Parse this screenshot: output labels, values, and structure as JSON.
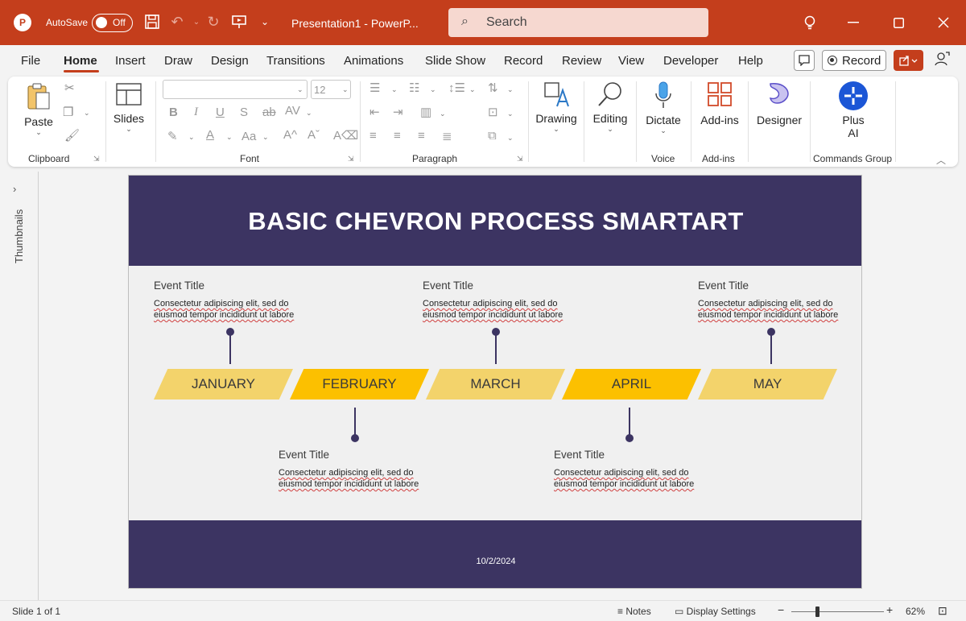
{
  "titlebar": {
    "autosave_label": "AutoSave",
    "autosave_state": "Off",
    "document_title": "Presentation1  -  PowerP...",
    "search_placeholder": "Search",
    "app_icon": "powerpoint-logo-icon",
    "accent_color": "#c43e1c"
  },
  "menu": {
    "tabs": [
      "File",
      "Home",
      "Insert",
      "Draw",
      "Design",
      "Transitions",
      "Animations",
      "Slide Show",
      "Record",
      "Review",
      "View",
      "Developer",
      "Help"
    ],
    "active_tab": "Home",
    "record_label": "Record"
  },
  "ribbon": {
    "clipboard": {
      "paste": "Paste",
      "group": "Clipboard"
    },
    "slides": {
      "label": "Slides"
    },
    "font": {
      "size": "12",
      "group": "Font"
    },
    "paragraph": {
      "group": "Paragraph"
    },
    "drawing": {
      "label": "Drawing"
    },
    "editing": {
      "label": "Editing"
    },
    "voice": {
      "dictate": "Dictate",
      "group": "Voice"
    },
    "addins": {
      "label": "Add-ins",
      "group": "Add-ins"
    },
    "designer": {
      "label": "Designer"
    },
    "commands": {
      "plus": "Plus",
      "ai": "AI",
      "group": "Commands Group"
    }
  },
  "thumbnails": {
    "label": "Thumbnails"
  },
  "slide": {
    "title": "BASIC CHEVRON PROCESS SMARTART",
    "date": "10/2/2024",
    "header_color": "#3c3462",
    "chevrons": [
      "JANUARY",
      "FEBRUARY",
      "MARCH",
      "APRIL",
      "MAY"
    ],
    "chevron_colors": {
      "light": "#f3d36b",
      "dark": "#fcc000"
    },
    "events_top": [
      {
        "title": "Event Title",
        "desc": "Consectetur adipiscing elit, sed do eiusmod tempor incididunt ut labore"
      },
      {
        "title": "Event Title",
        "desc": "Consectetur adipiscing elit, sed do eiusmod tempor incididunt ut labore"
      },
      {
        "title": "Event Title",
        "desc": "Consectetur adipiscing elit, sed do eiusmod tempor incididunt ut labore"
      }
    ],
    "events_bottom": [
      {
        "title": "Event Title",
        "desc": "Consectetur adipiscing elit, sed do eiusmod tempor incididunt ut labore"
      },
      {
        "title": "Event Title",
        "desc": "Consectetur adipiscing elit, sed do eiusmod tempor incididunt ut labore"
      }
    ]
  },
  "status": {
    "slide_info": "Slide 1 of 1",
    "notes": "Notes",
    "display_settings": "Display Settings",
    "zoom": "62%"
  }
}
